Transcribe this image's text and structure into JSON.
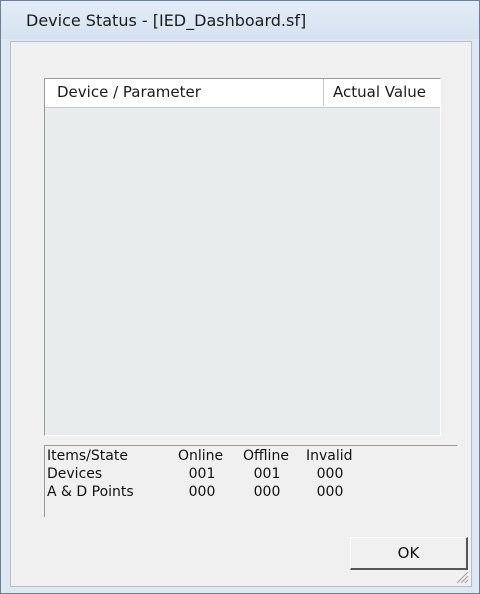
{
  "window": {
    "title": "Device Status - [IED_Dashboard.sf]"
  },
  "list": {
    "columns": [
      "Device / Parameter",
      "Actual Value"
    ]
  },
  "summary": {
    "headers": [
      "Items/State",
      "Online",
      "Offline",
      "Invalid"
    ],
    "rows": [
      {
        "label": "Devices",
        "online": "001",
        "offline": "001",
        "invalid": "000"
      },
      {
        "label": "A & D Points",
        "online": "000",
        "offline": "000",
        "invalid": "000"
      }
    ]
  },
  "buttons": {
    "ok": "OK"
  },
  "icons": {
    "resize_grip": "resize-grip-icon"
  }
}
